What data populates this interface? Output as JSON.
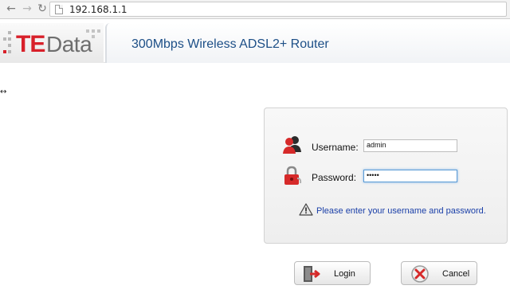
{
  "browser": {
    "url": "192.168.1.1"
  },
  "header": {
    "logo_te": "TE",
    "logo_data": "Data",
    "title": "300Mbps Wireless ADSL2+ Router"
  },
  "login": {
    "username_label": "Username:",
    "username_value": "admin",
    "password_label": "Password:",
    "password_value": "•••••",
    "hint": "Please enter your username and password."
  },
  "buttons": {
    "login_label": "Login",
    "cancel_label": "Cancel"
  },
  "colors": {
    "brand_red": "#d8202a",
    "title_blue": "#1d4f87",
    "hint_blue": "#1a3fa8"
  }
}
